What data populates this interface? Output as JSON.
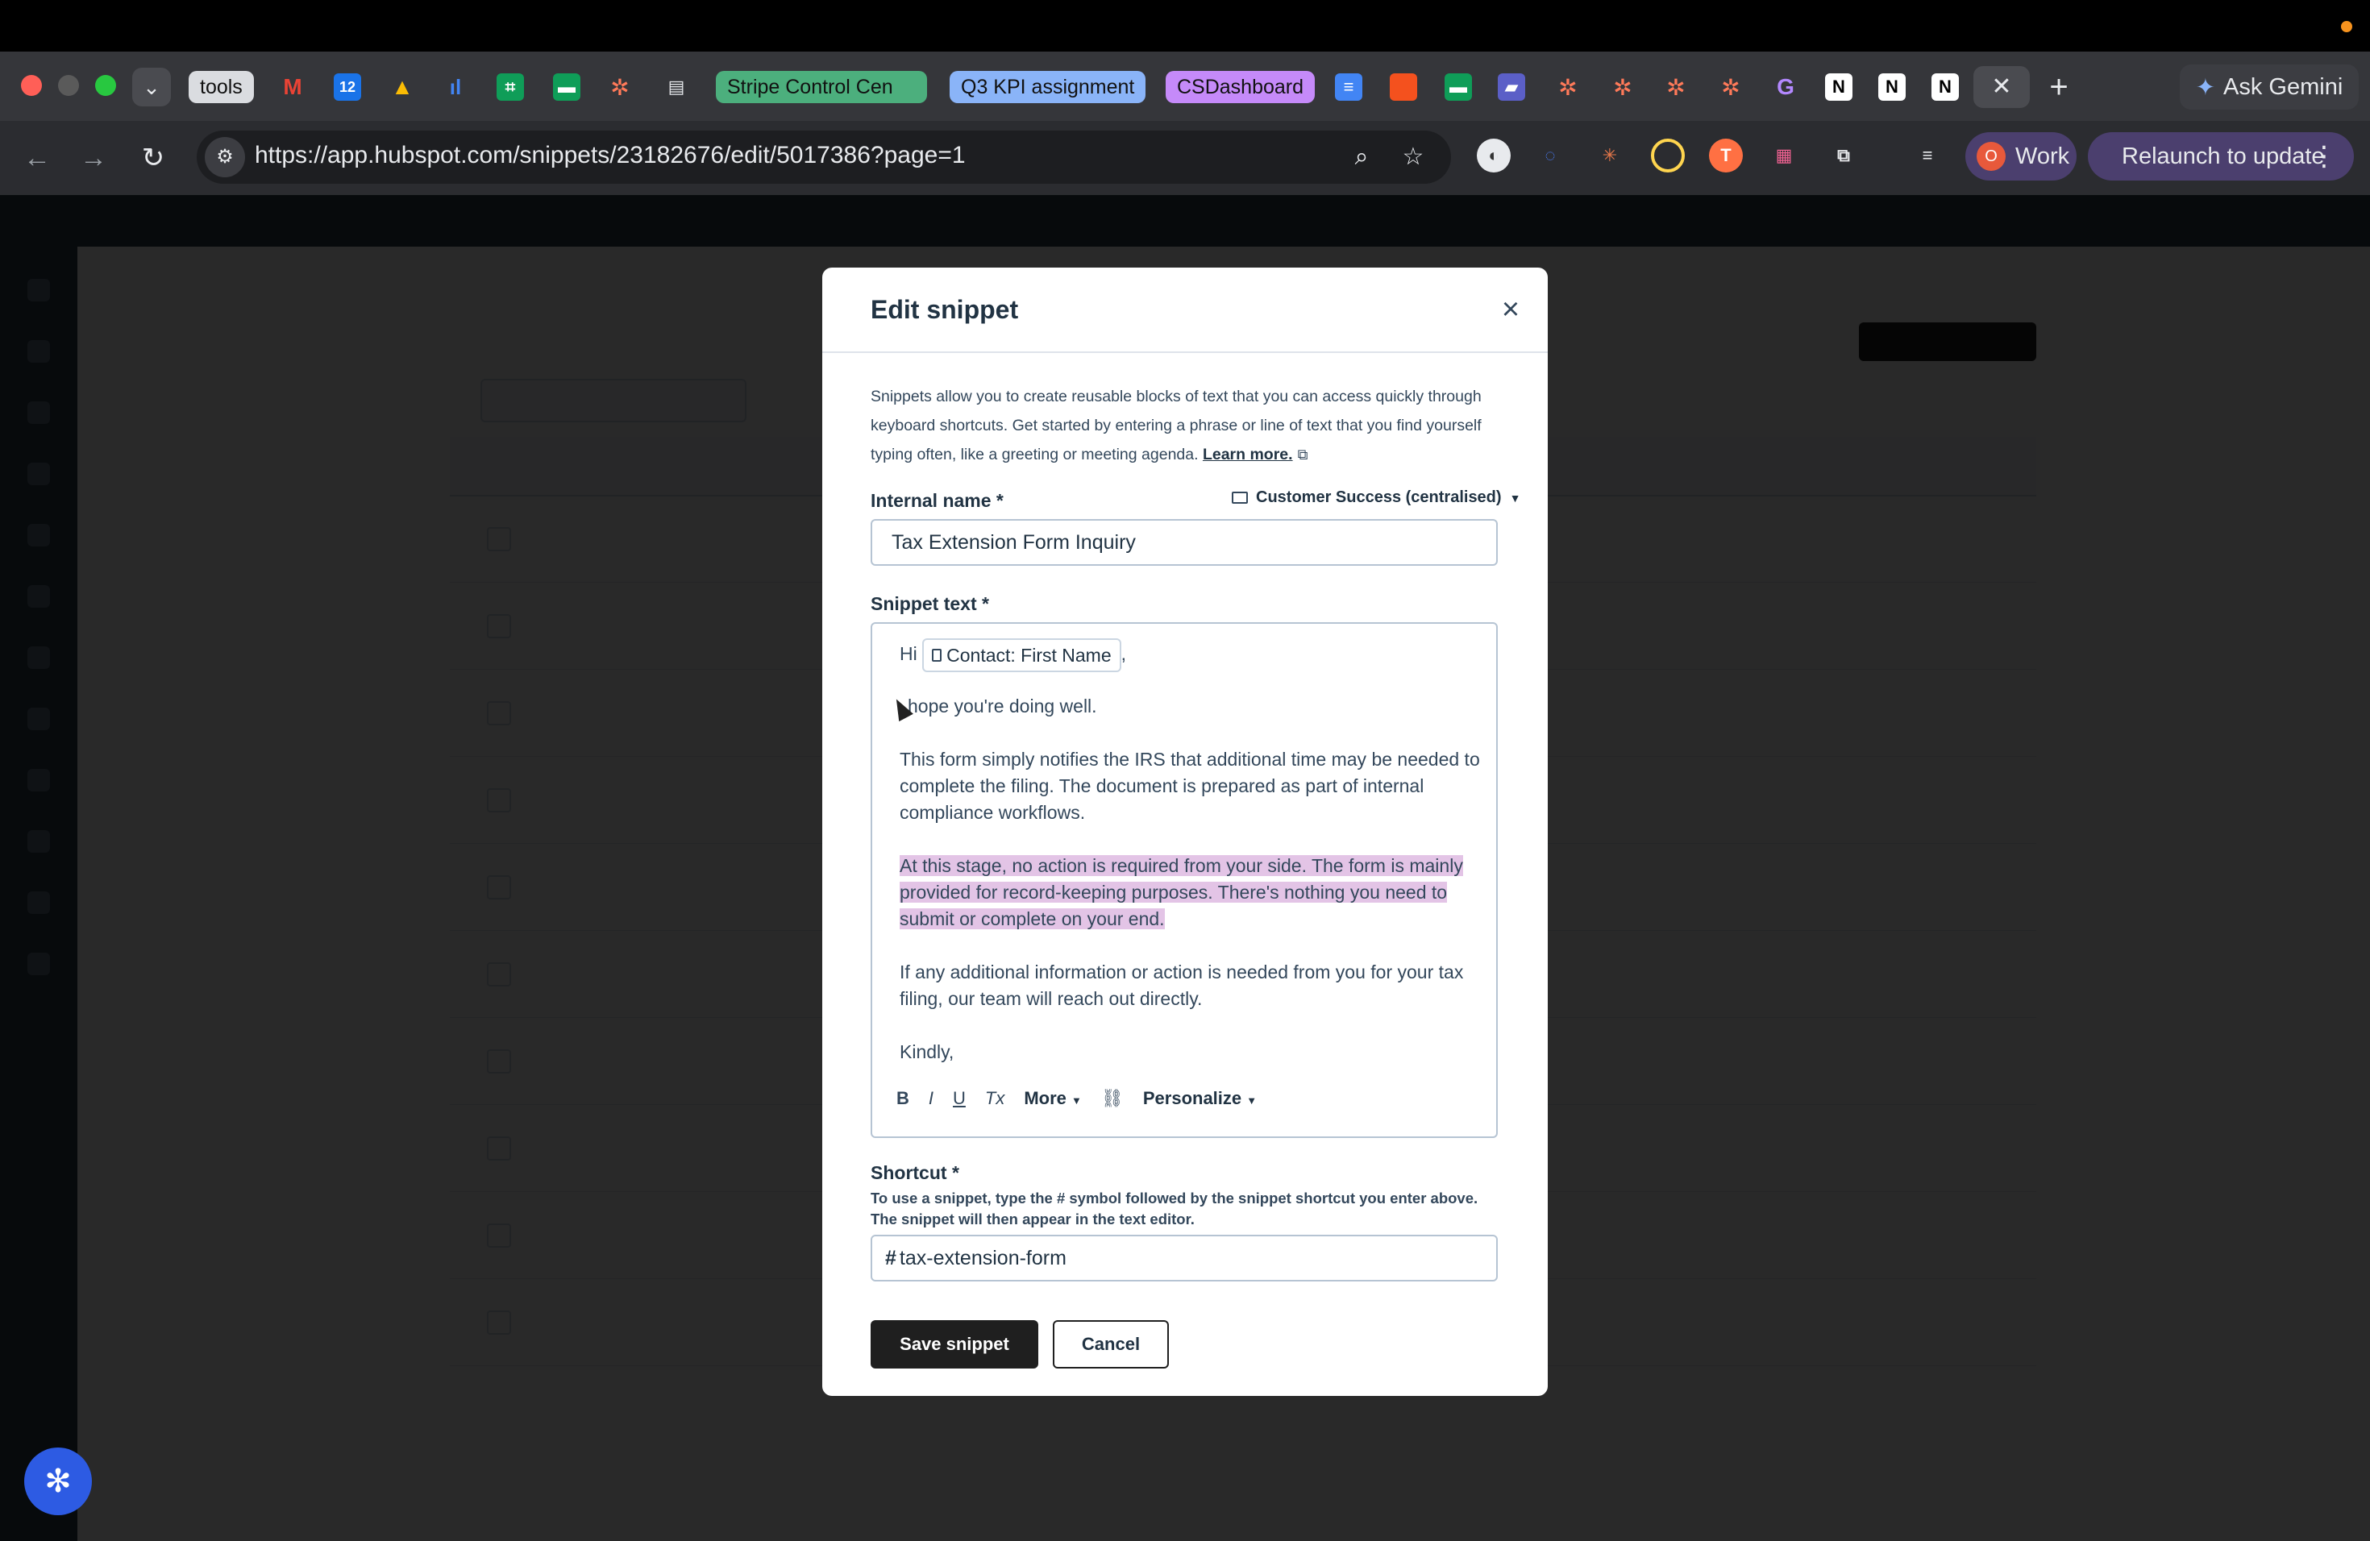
{
  "browser": {
    "tabs": {
      "tools": "tools",
      "stripe": "Stripe Control Cen",
      "q3kpi": "Q3 KPI assignment",
      "csdashboard": "CSDashboard"
    },
    "url": "https://app.hubspot.com/snippets/23182676/edit/5017386?page=1",
    "gemini_label": "Ask Gemini",
    "profile_label": "Work",
    "profile_initial": "O",
    "relaunch_label": "Relaunch to update",
    "colors": {
      "tab_green": "#4caf7d",
      "tab_blue": "#8ab4f8",
      "tab_purple": "#c58af9",
      "profile": "#4b3f6e"
    }
  },
  "modal": {
    "title": "Edit snippet",
    "description": "Snippets allow you to create reusable blocks of text that you can access quickly through keyboard shortcuts. Get started by entering a phrase or line of text that you find yourself typing often, like a greeting or meeting agenda.",
    "learn_more": "Learn more.",
    "internal_name_label": "Internal name *",
    "folder": "Customer Success (centralised)",
    "internal_name_value": "Tax Extension Form Inquiry",
    "snippet_text_label": "Snippet text *",
    "editor": {
      "greeting_prefix": "Hi",
      "token_label": "Contact: First Name",
      "greeting_suffix": ",",
      "line1": "hope you're doing well.",
      "para1": "This form simply notifies the IRS that additional time may be needed to complete the filing. The document is prepared as part of internal compliance workflows.",
      "para2_highlighted": "At this stage, no action is required from your side. The form is mainly provided for record-keeping purposes. There's nothing you need to submit or complete on your end.",
      "para3": "If any additional information or action is needed from you for your tax filing, our team will reach out directly.",
      "closing": "Kindly,",
      "toolbar": {
        "bold": "B",
        "italic": "I",
        "underline": "U",
        "clear": "Tx",
        "more": "More",
        "personalize": "Personalize"
      }
    },
    "shortcut_label": "Shortcut *",
    "shortcut_help": "To use a snippet, type the # symbol followed by the snippet shortcut you enter above. The snippet will then appear in the text editor.",
    "shortcut_hash": "#",
    "shortcut_value": "tax-extension-form",
    "save_label": "Save snippet",
    "cancel_label": "Cancel"
  }
}
